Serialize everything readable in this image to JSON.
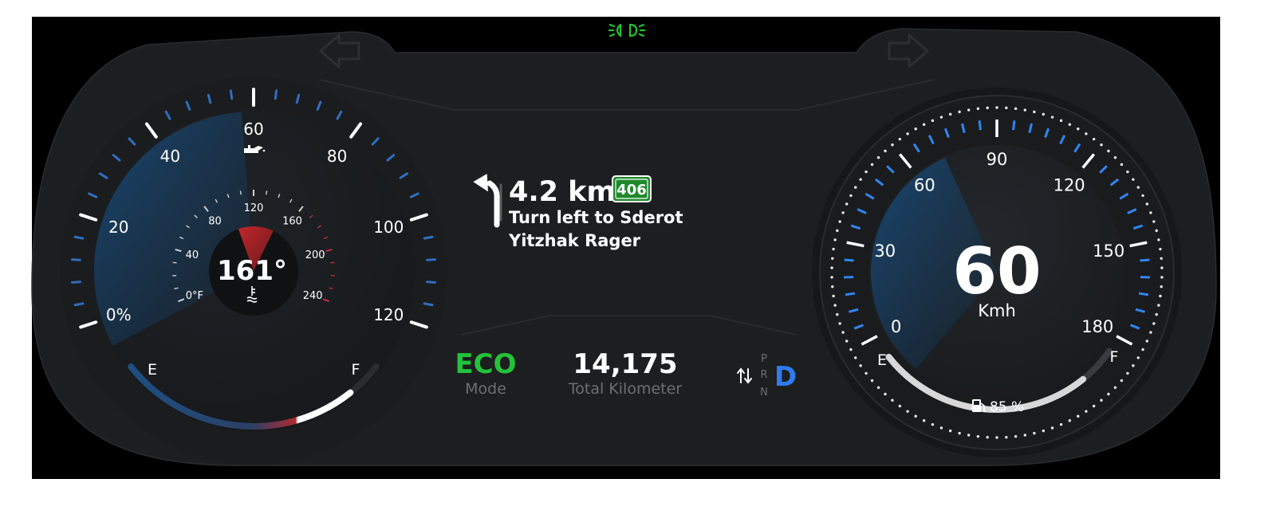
{
  "indicators": {
    "left_turn_icon": "left-turn-arrow",
    "right_turn_icon": "right-turn-arrow",
    "headlight_icon": "low-beam-headlight",
    "headlight_color": "#1ec531"
  },
  "left_gauge": {
    "outer_labels": [
      "0%",
      "20",
      "40",
      "60",
      "80",
      "100",
      "120"
    ],
    "oil_icon": "oil-can-icon",
    "fuel_e_label": "E",
    "fuel_f_label": "F",
    "fuel_level": 0.87,
    "sweep_level": 0.48,
    "temperature": {
      "value_text": "161°",
      "scale_labels": [
        "0°F",
        "40",
        "80",
        "120",
        "160",
        "200",
        "240"
      ],
      "value": 161,
      "min": 0,
      "max": 240,
      "icon": "coolant-temperature-icon"
    }
  },
  "navigation": {
    "turn_icon": "turn-left-arrow",
    "distance": "4.2 km",
    "road_number": "406",
    "road_color": "#1d8a2a",
    "instruction_line1": "Turn left  to Sderot",
    "instruction_line2": "Yitzhak Rager"
  },
  "status": {
    "mode_value": "ECO",
    "mode_label": "Mode",
    "mode_color": "#22c33a",
    "odometer_value": "14,175",
    "odometer_label": "Total Kilometer",
    "gears": [
      "P",
      "R",
      "N"
    ],
    "active_gear": "D",
    "gear_color": "#2f7cf0",
    "gear_icon": "gear-shift-arrows-icon"
  },
  "speedometer": {
    "speed": "60",
    "unit": "Kmh",
    "labels": [
      "0",
      "30",
      "60",
      "90",
      "120",
      "150",
      "180"
    ],
    "max_speed": 180,
    "speed_value": 60,
    "fuel_e_label": "E",
    "fuel_f_label": "F",
    "fuel_percent_text": "85 %",
    "fuel_level": 0.85,
    "fuel_icon": "fuel-pump-icon",
    "accent_color": "#2f86f0"
  }
}
